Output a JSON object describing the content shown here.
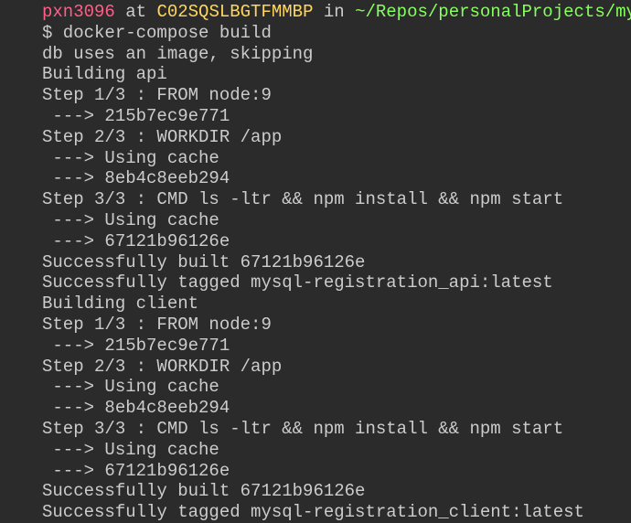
{
  "prompt": {
    "user": "pxn3096",
    "at": " at ",
    "host": "C02SQSLBGTFMMBP",
    "in": " in ",
    "path": "~/Repos/personalProjects/mys"
  },
  "lines": [
    "$ docker-compose build",
    "db uses an image, skipping",
    "Building api",
    "Step 1/3 : FROM node:9",
    " ---> 215b7ec9e771",
    "Step 2/3 : WORKDIR /app",
    " ---> Using cache",
    " ---> 8eb4c8eeb294",
    "Step 3/3 : CMD ls -ltr && npm install && npm start",
    " ---> Using cache",
    " ---> 67121b96126e",
    "Successfully built 67121b96126e",
    "Successfully tagged mysql-registration_api:latest",
    "Building client",
    "Step 1/3 : FROM node:9",
    " ---> 215b7ec9e771",
    "Step 2/3 : WORKDIR /app",
    " ---> Using cache",
    " ---> 8eb4c8eeb294",
    "Step 3/3 : CMD ls -ltr && npm install && npm start",
    " ---> Using cache",
    " ---> 67121b96126e",
    "Successfully built 67121b96126e",
    "Successfully tagged mysql-registration_client:latest"
  ]
}
